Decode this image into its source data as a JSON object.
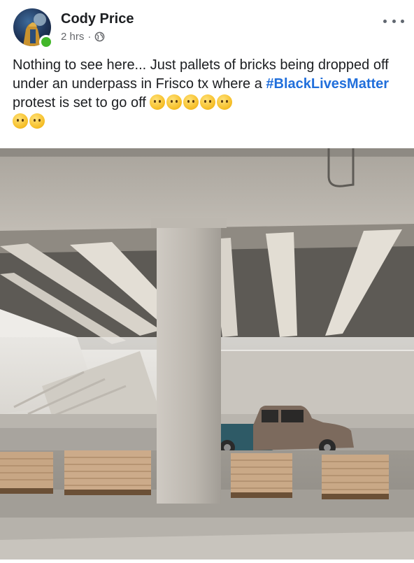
{
  "post": {
    "author_name": "Cody Price",
    "timestamp": "2 hrs",
    "separator": "·",
    "privacy_icon": "globe-icon",
    "more_options_icon": "more-dots-icon",
    "text_part1": "Nothing to see here... Just pallets of bricks being dropped off under an underpass in Frisco tx where a ",
    "hashtag": "#BlackLivesMatter",
    "text_part2": " protest is set to go off ",
    "emoji_name": "thinking-face-emoji",
    "emoji_count": 7
  },
  "colors": {
    "hashtag": "#216fdb",
    "online": "#42b72a",
    "meta_text": "#65676b"
  },
  "photo": {
    "subject": "highway underpass with pallets of bricks and a pickup truck"
  }
}
